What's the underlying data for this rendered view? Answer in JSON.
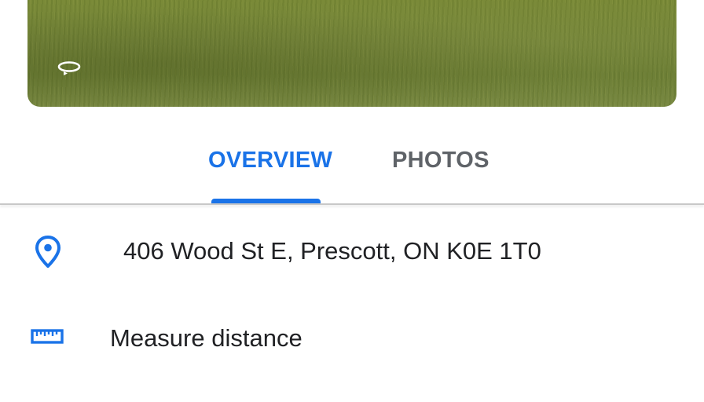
{
  "photo": {
    "rotate_icon": "rotate-360-icon"
  },
  "tabs": [
    {
      "label": "OVERVIEW",
      "selected": true
    },
    {
      "label": "PHOTOS",
      "selected": false
    }
  ],
  "colors": {
    "accent": "#1a73e8",
    "tab_inactive": "#5f6368",
    "text": "#202124"
  },
  "details": {
    "address": {
      "icon": "location-pin-icon",
      "text": "406 Wood St E, Prescott, ON K0E 1T0"
    },
    "measure": {
      "icon": "ruler-icon",
      "text": "Measure distance"
    }
  }
}
